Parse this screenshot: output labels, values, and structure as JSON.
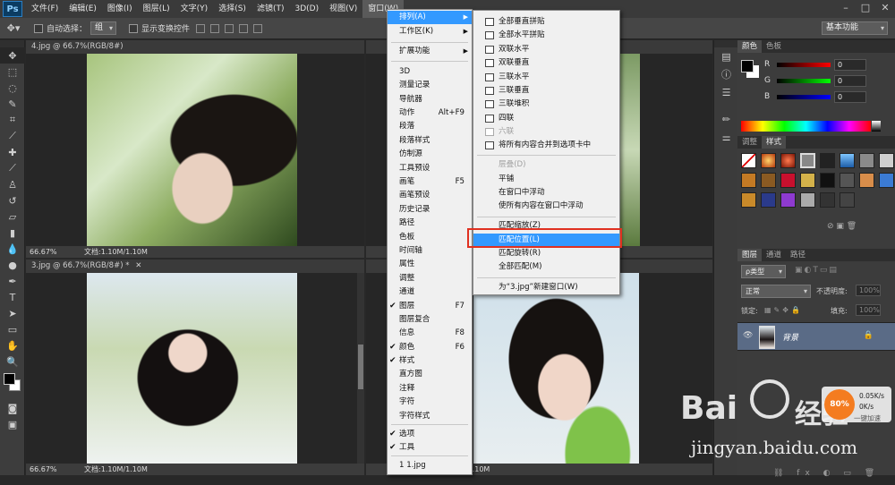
{
  "menubar": {
    "logo": "Ps",
    "items": [
      "文件(F)",
      "编辑(E)",
      "图像(I)",
      "图层(L)",
      "文字(Y)",
      "选择(S)",
      "滤镜(T)",
      "3D(D)",
      "视图(V)",
      "窗口(W)"
    ],
    "window_controls": [
      "–",
      "□",
      "✕"
    ]
  },
  "optionsbar": {
    "auto_select_label": "自动选择：",
    "auto_select_value": "组",
    "show_transform_label": "显示变换控件",
    "workspace": "基本功能"
  },
  "documents": [
    {
      "tab": "4.jpg @ 66.7%(RGB/8#)",
      "zoom": "66.67%",
      "status": "文档:1.10M/1.10M"
    },
    {
      "tab": "3.jpg @ 66.7%(RGB/8#) *",
      "zoom": "66.67%",
      "status": "文档:1.10M/1.10M"
    },
    {
      "tab": "",
      "zoom": "",
      "status": "M/1.10M"
    },
    {
      "tab": "",
      "zoom": "66.67%",
      "status": ""
    }
  ],
  "window_menu": {
    "items": [
      {
        "label": "排列(A)",
        "submenu": true,
        "highlight": true
      },
      {
        "label": "工作区(K)",
        "submenu": true
      },
      {
        "label": "扩展功能",
        "submenu": true
      },
      {
        "label": "3D"
      },
      {
        "label": "测量记录"
      },
      {
        "label": "导航器"
      },
      {
        "label": "动作",
        "shortcut": "Alt+F9"
      },
      {
        "label": "段落"
      },
      {
        "label": "段落样式"
      },
      {
        "label": "仿制源"
      },
      {
        "label": "工具预设"
      },
      {
        "label": "画笔",
        "shortcut": "F5"
      },
      {
        "label": "画笔预设"
      },
      {
        "label": "历史记录"
      },
      {
        "label": "路径"
      },
      {
        "label": "色板"
      },
      {
        "label": "时间轴"
      },
      {
        "label": "属性"
      },
      {
        "label": "调整"
      },
      {
        "label": "通道"
      },
      {
        "label": "图层",
        "shortcut": "F7",
        "checked": true
      },
      {
        "label": "图层复合"
      },
      {
        "label": "信息",
        "shortcut": "F8"
      },
      {
        "label": "颜色",
        "shortcut": "F6",
        "checked": true
      },
      {
        "label": "样式",
        "checked": true
      },
      {
        "label": "直方图"
      },
      {
        "label": "注释"
      },
      {
        "label": "字符"
      },
      {
        "label": "字符样式"
      },
      {
        "label": "选项",
        "checked": true
      },
      {
        "label": "工具",
        "checked": true
      },
      {
        "label": "1 1.jpg"
      }
    ]
  },
  "arrange_menu": {
    "items": [
      {
        "label": "全部垂直拼贴",
        "icon": true
      },
      {
        "label": "全部水平拼贴",
        "icon": true
      },
      {
        "label": "双联水平",
        "icon": true
      },
      {
        "label": "双联垂直",
        "icon": true
      },
      {
        "label": "三联水平",
        "icon": true
      },
      {
        "label": "三联垂直",
        "icon": true
      },
      {
        "label": "三联堆积",
        "icon": true
      },
      {
        "label": "四联",
        "icon": true
      },
      {
        "label": "六联",
        "icon": true,
        "disabled": true
      },
      {
        "label": "将所有内容合并到选项卡中",
        "icon": true
      },
      {
        "label": "层叠(D)",
        "disabled": true
      },
      {
        "label": "平铺"
      },
      {
        "label": "在窗口中浮动"
      },
      {
        "label": "使所有内容在窗口中浮动"
      },
      {
        "label": "匹配缩放(Z)"
      },
      {
        "label": "匹配位置(L)",
        "highlight": true
      },
      {
        "label": "匹配旋转(R)"
      },
      {
        "label": "全部匹配(M)"
      },
      {
        "label": "为“3.jpg”新建窗口(W)"
      }
    ]
  },
  "color_panel": {
    "tabs": [
      "颜色",
      "色板"
    ],
    "channels": [
      {
        "label": "R",
        "value": "0"
      },
      {
        "label": "G",
        "value": "0"
      },
      {
        "label": "B",
        "value": "0"
      }
    ]
  },
  "styles_panel": {
    "tabs": [
      "调整",
      "样式"
    ]
  },
  "layers_panel": {
    "tabs": [
      "图层",
      "通道",
      "路径"
    ],
    "filter_label": "ρ类型",
    "blend_mode": "正常",
    "opacity_label": "不透明度:",
    "opacity_value": "100%",
    "lock_label": "锁定:",
    "fill_label": "填充:",
    "fill_value": "100%",
    "layers": [
      {
        "name": "背景",
        "locked": true
      }
    ]
  },
  "net_widget": {
    "percent": "80%",
    "up": "0.05K/s",
    "down": "0K/s",
    "caption": "一键加速"
  },
  "watermark": {
    "brand": "Bai",
    "brand2": "经验",
    "url": "jingyan.baidu.com"
  },
  "colors": {
    "highlight": "#3399ff",
    "annotation_box": "#e03020",
    "ui_dark": "#3c3c3c"
  }
}
